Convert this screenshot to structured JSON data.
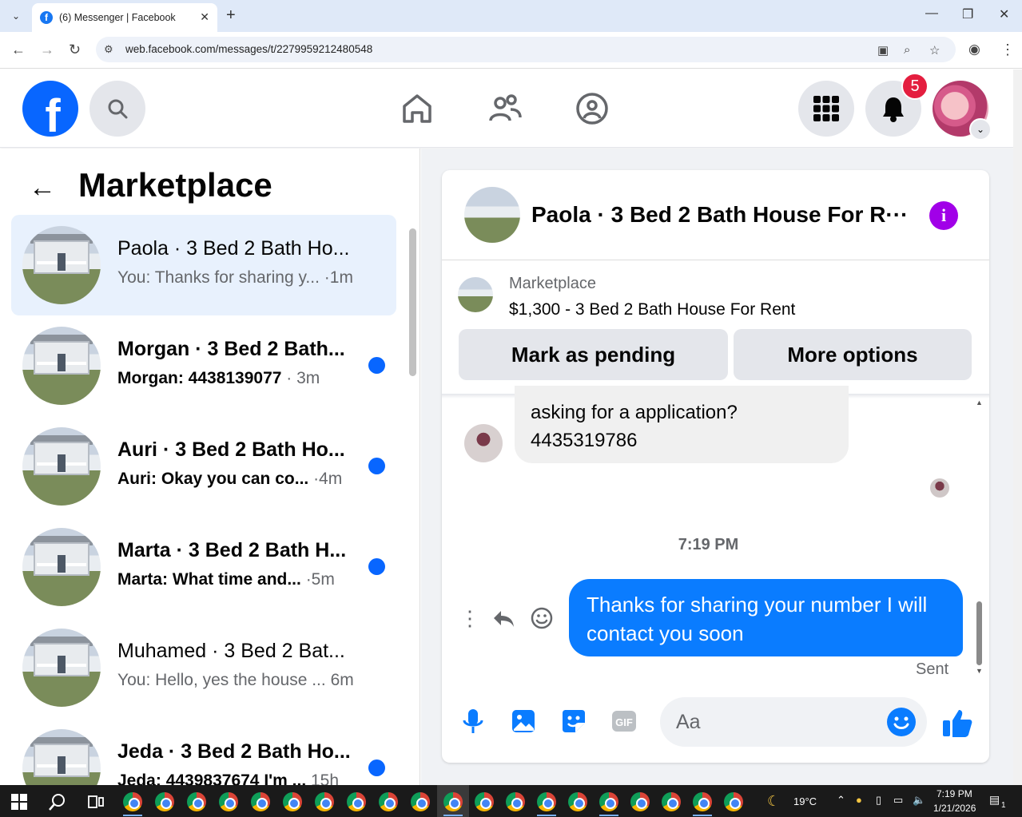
{
  "browser": {
    "tab_title": "(6) Messenger | Facebook",
    "url": "web.facebook.com/messages/t/2279959212480548"
  },
  "fb": {
    "notification_count": "5"
  },
  "left": {
    "title": "Marketplace",
    "conversations": [
      {
        "name": "Paola · 3 Bed 2 Bath Ho...",
        "preview": "You: Thanks for sharing y...",
        "time": " ·1m",
        "unread": false,
        "active": true
      },
      {
        "name": "Morgan · 3 Bed 2 Bath...",
        "preview": "Morgan: 4438139077",
        "time": " · 3m",
        "unread": true,
        "active": false
      },
      {
        "name": "Auri · 3 Bed 2 Bath Ho...",
        "preview": "Auri: Okay you can co...",
        "time": " ·4m",
        "unread": true,
        "active": false
      },
      {
        "name": "Marta · 3 Bed 2 Bath H...",
        "preview": "Marta: What time and...",
        "time": " ·5m",
        "unread": true,
        "active": false
      },
      {
        "name": "Muhamed · 3 Bed 2 Bat...",
        "preview": "You: Hello, yes the house ...",
        "time": " 6m",
        "unread": false,
        "active": false
      },
      {
        "name": "Jeda · 3 Bed 2 Bath Ho...",
        "preview": "Jeda: 4439837674 I'm ...",
        "time": " 15h",
        "unread": true,
        "active": false
      }
    ]
  },
  "chat": {
    "title": "Paola · 3 Bed 2 Bath House For R···",
    "marketplace_label": "Marketplace",
    "listing": "$1,300 - 3 Bed 2 Bath House For Rent",
    "mark_pending": "Mark as pending",
    "more_options": "More options",
    "incoming_line1": "asking for a application?",
    "incoming_line2": "4435319786",
    "timestamp": "7:19 PM",
    "outgoing": "Thanks for sharing your number I will contact you soon",
    "status": "Sent",
    "composer_placeholder": "Aa"
  },
  "taskbar": {
    "weather": "19°C",
    "time": "7:19 PM",
    "date": "1/21/2026",
    "notif": "1"
  }
}
